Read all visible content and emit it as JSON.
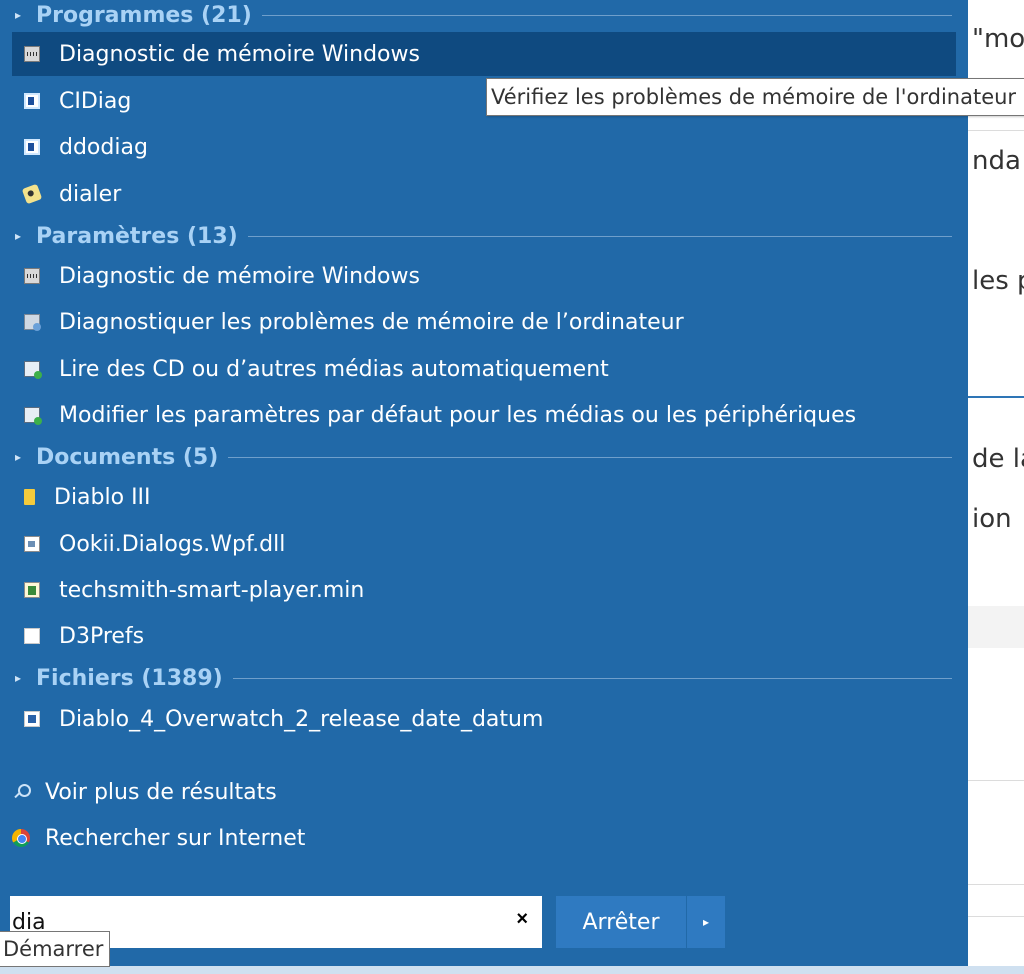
{
  "background": {
    "snippets": [
      "\"mo",
      "nda",
      "les p",
      "de la",
      "ion"
    ]
  },
  "groups": {
    "programmes": {
      "label": "Programmes (21)",
      "items": [
        "Diagnostic de mémoire Windows",
        "CIDiag",
        "ddodiag",
        "dialer"
      ]
    },
    "parametres": {
      "label": "Paramètres (13)",
      "items": [
        "Diagnostic de mémoire Windows",
        "Diagnostiquer les problèmes de mémoire de l’ordinateur",
        "Lire des CD ou d’autres médias automatiquement",
        "Modifier les paramètres par défaut pour les médias ou les périphériques"
      ]
    },
    "documents": {
      "label": "Documents (5)",
      "items": [
        "Diablo III",
        "Ookii.Dialogs.Wpf.dll",
        "techsmith-smart-player.min",
        "D3Prefs"
      ]
    },
    "fichiers": {
      "label": "Fichiers (1389)",
      "items": [
        "Diablo_4_Overwatch_2_release_date_datum"
      ]
    }
  },
  "actions": {
    "more_results": "Voir plus de résultats",
    "search_web": "Rechercher sur Internet"
  },
  "tooltip": "Vérifiez les problèmes de mémoire de l'ordinateur",
  "search": {
    "value": "dia",
    "clear": "×"
  },
  "buttons": {
    "stop": "Arrêter",
    "power_arrow": "▸"
  },
  "start_tooltip": "Démarrer",
  "arrow_glyph": "▸",
  "icons": {
    "programmes": [
      "memory-chip-icon",
      "window-app-icon",
      "window-app-icon",
      "phone-dialer-icon"
    ],
    "parametres": [
      "memory-chip-icon",
      "diagnose-settings-icon",
      "autoplay-media-icon",
      "autoplay-media-icon"
    ],
    "documents": [
      "folder-icon",
      "dll-file-icon",
      "script-file-icon",
      "document-icon"
    ],
    "fichiers": [
      "image-file-icon"
    ]
  },
  "colors": {
    "panel": "#2169a8",
    "selected": "#0f4a80",
    "header_text": "#a9d2f5",
    "button": "#2f7ac1"
  }
}
